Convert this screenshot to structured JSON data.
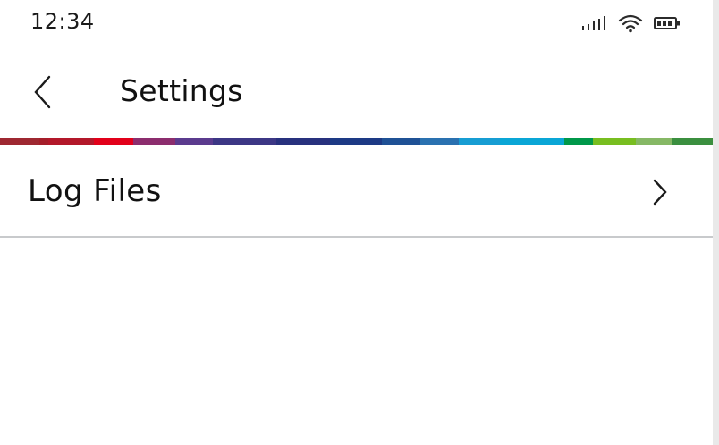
{
  "status_bar": {
    "time": "12:34",
    "icons": [
      "signal-icon",
      "wifi-icon",
      "battery-icon"
    ]
  },
  "header": {
    "title": "Settings",
    "back_icon": "chevron-left-icon"
  },
  "supergraphic_colors": [
    "#9e2831",
    "#a51e2a",
    "#b3182a",
    "#e2001a",
    "#8c2d6e",
    "#5b3b8e",
    "#3c3785",
    "#28317e",
    "#1d3a85",
    "#1f5195",
    "#2a71b0",
    "#179dd3",
    "#0aa6d6",
    "#00984a",
    "#78be20",
    "#86b865",
    "#3b8f3f"
  ],
  "settings_list": [
    {
      "label": "Log Files",
      "icon": "chevron-right-icon"
    }
  ]
}
